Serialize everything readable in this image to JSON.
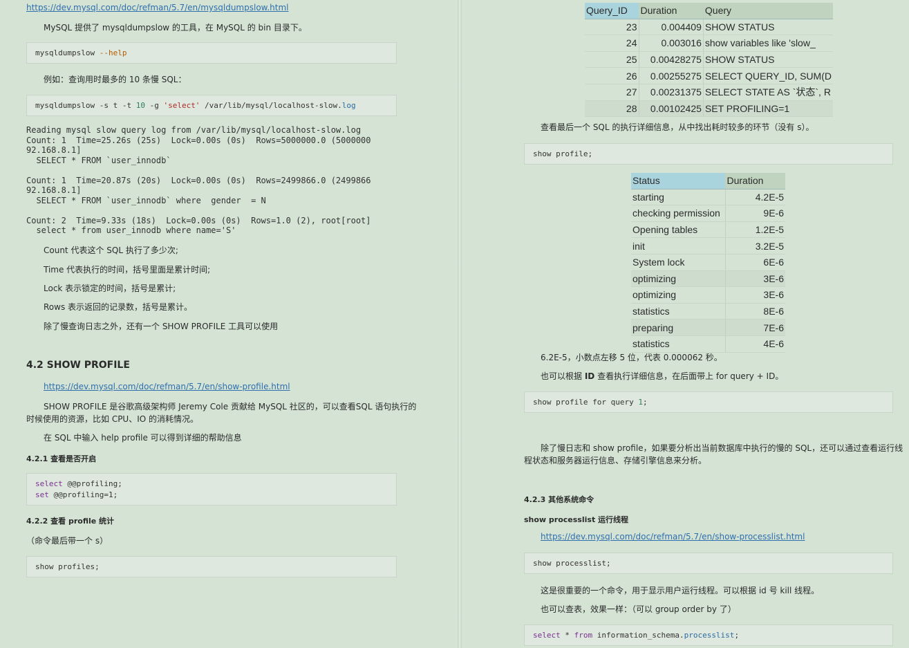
{
  "left": {
    "link_dumpslow": "https://dev.mysql.com/doc/refman/5.7/en/mysqldumpslow.html",
    "p_dumpslow": "MySQL 提供了 mysqldumpslow 的工具，在 MySQL 的 bin 目录下。",
    "code_help_cmd": "mysqldumpslow ",
    "code_help_opt": "--help",
    "p_example": "例如：查询用时最多的 10 条慢 SQL：",
    "code2_a": "mysqldumpslow -s t -t ",
    "code2_num": "10",
    "code2_b": " -g ",
    "code2_str": "'select'",
    "code2_c": " /var/lib/mysql/localhost-slow.",
    "code2_log": "log",
    "output": [
      "Reading mysql slow query log from /var/lib/mysql/localhost-slow.log",
      "Count: 1  Time=25.26s (25s)  Lock=0.00s (0s)  Rows=5000000.0 (5000000",
      "92.168.8.1]",
      "  SELECT * FROM `user_innodb`",
      "",
      "Count: 1  Time=20.87s (20s)  Lock=0.00s (0s)  Rows=2499866.0 (2499866",
      "92.168.8.1]",
      "  SELECT * FROM `user_innodb` where  gender  = N",
      "",
      "Count: 2  Time=9.33s (18s)  Lock=0.00s (0s)  Rows=1.0 (2), root[root]",
      "  select * from user_innodb where name='S'"
    ],
    "p_count": "Count 代表这个 SQL 执行了多少次;",
    "p_time": "Time 代表执行的时间，括号里面是累计时间;",
    "p_lock": "Lock 表示锁定的时间，括号是累计;",
    "p_rows": "Rows 表示返回的记录数，括号是累计。",
    "p_besides": "除了慢查询日志之外，还有一个 SHOW PROFILE 工具可以使用",
    "h_42": "4.2 SHOW PROFILE",
    "link_profile": "https://dev.mysql.com/doc/refman/5.7/en/show-profile.html",
    "p_profile_1": "SHOW PROFILE 是谷歌高级架构师 Jeremy Cole 贡献给 MySQL 社区的，可以查看SQL 语句执行的",
    "p_profile_2": "时候使用的资源，比如 CPU、IO 的消耗情况。",
    "p_help": "在 SQL 中输入 help profile 可以得到详细的帮助信息",
    "h_421": "4.2.1 查看是否开启",
    "code3_kw1": "select",
    "code3_l1": " @@profiling;",
    "code3_kw2": "set",
    "code3_l2": " @@profiling=1;",
    "h_422": "4.2.2 查看 profile 统计",
    "p_note": "（命令最后带一个 s）",
    "code4": "show profiles;"
  },
  "right": {
    "table1": {
      "headers": [
        "Query_ID",
        "Duration",
        "Query"
      ],
      "rows": [
        [
          "23",
          "0.004409",
          "SHOW STATUS"
        ],
        [
          "24",
          "0.003016",
          "show variables like 'slow_"
        ],
        [
          "25",
          "0.00428275",
          "SHOW STATUS"
        ],
        [
          "26",
          "0.00255275",
          "SELECT QUERY_ID, SUM(D"
        ],
        [
          "27",
          "0.00231375",
          "SELECT STATE AS `状态`, R"
        ],
        [
          "28",
          "0.00102425",
          "SET PROFILING=1"
        ]
      ]
    },
    "p_last": "查看最后一个 SQL 的执行详细信息，从中找出耗时较多的环节（没有 s）。",
    "code5": "show profile;",
    "table2": {
      "headers": [
        "Status",
        "Duration"
      ],
      "rows": [
        [
          "starting",
          "4.2E-5"
        ],
        [
          "checking permission",
          "9E-6"
        ],
        [
          "Opening tables",
          "1.2E-5"
        ],
        [
          "init",
          "3.2E-5"
        ],
        [
          "System lock",
          "6E-6"
        ],
        [
          "optimizing",
          "3E-6"
        ],
        [
          "optimizing",
          "3E-6"
        ],
        [
          "statistics",
          "8E-6"
        ],
        [
          "preparing",
          "7E-6"
        ],
        [
          "statistics",
          "4E-6"
        ]
      ]
    },
    "p_sci": "6.2E-5，小数点左移 5 位，代表 0.000062 秒。",
    "p_id_a": "也可以根据 ",
    "p_id_b": "ID",
    "p_id_c": " 查看执行详细信息，在后面带上 for query + ID。",
    "code6_a": "show profile for query ",
    "code6_num": "1",
    "code6_b": ";",
    "p_besides_1": "除了慢日志和 show profile，如果要分析出当前数据库中执行的慢的 SQL，还可以通过查看运行线",
    "p_besides_2": "程状态和服务器运行信息、存储引擎信息来分析。",
    "h_423": "4.2.3 其他系统命令",
    "h_processlist": "show processlist 运行线程",
    "link_processlist": "https://dev.mysql.com/doc/refman/5.7/en/show-processlist.html",
    "code7": "show processlist;",
    "p_important": "这是很重要的一个命令，用于显示用户运行线程。可以根据 id 号 kill 线程。",
    "p_table": "也可以查表，效果一样：（可以 group order by 了）",
    "code8_kw1": "select",
    "code8_a": " * ",
    "code8_kw2": "from",
    "code8_b": " information_schema.",
    "code8_c": "processlist",
    "code8_d": ";"
  }
}
